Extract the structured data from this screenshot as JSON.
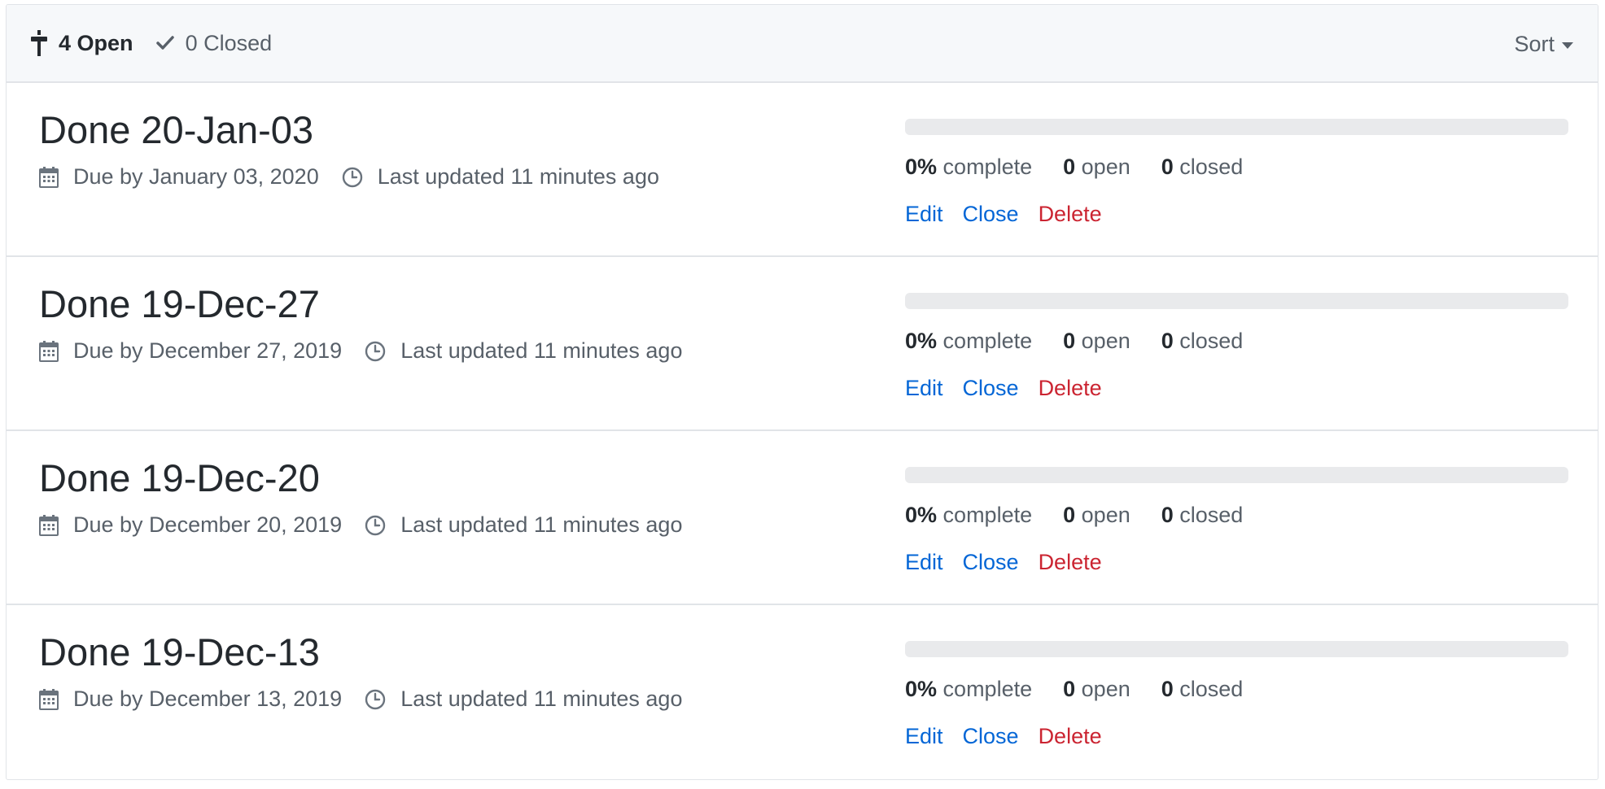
{
  "header": {
    "open_count": "4",
    "open_label": "Open",
    "closed_count": "0",
    "closed_label": "Closed",
    "sort_label": "Sort",
    "open_icon": "milestone-icon",
    "closed_icon": "check-icon"
  },
  "milestones": [
    {
      "title": "Done 20-Jan-03",
      "due": "Due by January 03, 2020",
      "updated": "Last updated 11 minutes ago",
      "percent": "0%",
      "percent_label": "complete",
      "open": "0",
      "open_label": "open",
      "closed": "0",
      "closed_label": "closed",
      "progress_fraction": 0,
      "actions": {
        "edit": "Edit",
        "close": "Close",
        "delete": "Delete"
      }
    },
    {
      "title": "Done 19-Dec-27",
      "due": "Due by December 27, 2019",
      "updated": "Last updated 11 minutes ago",
      "percent": "0%",
      "percent_label": "complete",
      "open": "0",
      "open_label": "open",
      "closed": "0",
      "closed_label": "closed",
      "progress_fraction": 0,
      "actions": {
        "edit": "Edit",
        "close": "Close",
        "delete": "Delete"
      }
    },
    {
      "title": "Done 19-Dec-20",
      "due": "Due by December 20, 2019",
      "updated": "Last updated 11 minutes ago",
      "percent": "0%",
      "percent_label": "complete",
      "open": "0",
      "open_label": "open",
      "closed": "0",
      "closed_label": "closed",
      "progress_fraction": 0,
      "actions": {
        "edit": "Edit",
        "close": "Close",
        "delete": "Delete"
      }
    },
    {
      "title": "Done 19-Dec-13",
      "due": "Due by December 13, 2019",
      "updated": "Last updated 11 minutes ago",
      "percent": "0%",
      "percent_label": "complete",
      "open": "0",
      "open_label": "open",
      "closed": "0",
      "closed_label": "closed",
      "progress_fraction": 0,
      "actions": {
        "edit": "Edit",
        "close": "Close",
        "delete": "Delete"
      }
    }
  ],
  "colors": {
    "link": "#0366d6",
    "danger": "#cb2431",
    "progress_track": "#e9eaec",
    "progress_fill": "#28a745"
  }
}
